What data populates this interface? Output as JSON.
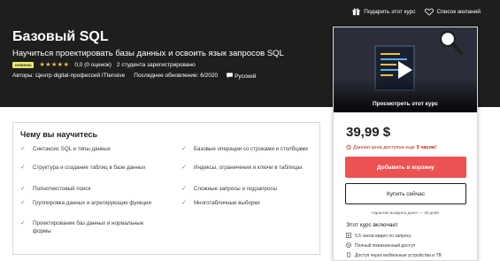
{
  "header": {
    "gift_label": "Подарить этот курс",
    "wishlist_label": "Список желаний"
  },
  "course": {
    "title": "Базовый SQL",
    "subtitle": "Научиться проектировать базы данных и освоить язык запросов SQL",
    "badge": "новинка",
    "stars": "★★★★★",
    "rating_text": "0,0 (0 оценок)",
    "students_text": "2 студента зарегистрировано",
    "authors": "Авторы: Центр digital-профессий ITtensive",
    "updated": "Последнее обновление: 6/2020",
    "language": "Русский"
  },
  "sidebar": {
    "preview_label": "Просмотреть этот курс",
    "price": "39,99 $",
    "timer_prefix": "Данная цена доступна еще",
    "timer_value": "5 часов!",
    "add_to_cart": "Добавить в корзину",
    "buy_now": "Купить сейчас",
    "guarantee": "Гарантия возврата денег — 30 дней",
    "includes_title": "Этот курс включает",
    "includes": [
      "5,5 часов видео по запросу",
      "Полный пожизненный доступ",
      "Доступ через мобильные устройства и ТВ"
    ]
  },
  "learn": {
    "title": "Чему вы научитесь",
    "left": [
      "Синтаксис SQL и типы данных",
      "Структура и создание таблиц в базе данных",
      "Полнотекстовый поиск",
      "Группировка данных и агрегирующие функции",
      "Проектирование баз данных и нормальные формы"
    ],
    "right": [
      "Базовые операции со строками и столбцами",
      "Индексы, ограничения и ключи в таблицах",
      "Сложные запросы и подзапросы",
      "Многотабличные выборки"
    ]
  },
  "colors": {
    "hero_bg": "#1e1e1c",
    "cta_red": "#ec5252",
    "star_gold": "#f4c150",
    "timer_red": "#b32d0f"
  },
  "icons": {
    "gift": "gift-icon",
    "wishlist": "heart-icon",
    "language": "speech-bubble-icon",
    "play": "play-icon",
    "magnifier": "magnifier-icon",
    "timer": "alarm-clock-icon",
    "check": "checkmark-icon"
  }
}
